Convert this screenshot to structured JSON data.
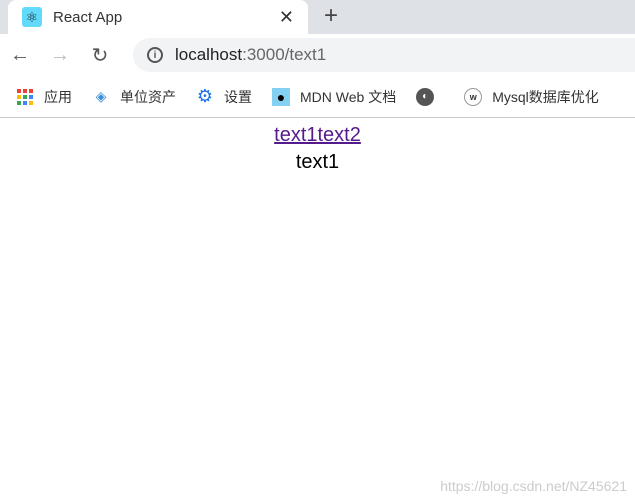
{
  "tab": {
    "title": "React App",
    "favicon": "react-icon",
    "close": "✕",
    "new_tab": "+"
  },
  "toolbar": {
    "back": "←",
    "forward": "→",
    "reload": "↻",
    "url_host": "localhost",
    "url_rest": ":3000/text1"
  },
  "bookmarks": [
    {
      "label": "应用",
      "icon": "apps-grid-icon"
    },
    {
      "label": "单位资产",
      "icon": "site-icon"
    },
    {
      "label": "设置",
      "icon": "gear-icon"
    },
    {
      "label": "MDN Web 文档",
      "icon": "mdn-icon"
    },
    {
      "label": "",
      "icon": "globe-icon"
    },
    {
      "label": "Mysql数据库优化",
      "icon": "w-icon"
    }
  ],
  "page": {
    "links": [
      "text1",
      "text2"
    ],
    "text": "text1"
  },
  "watermark": "https://blog.csdn.net/NZ45621"
}
